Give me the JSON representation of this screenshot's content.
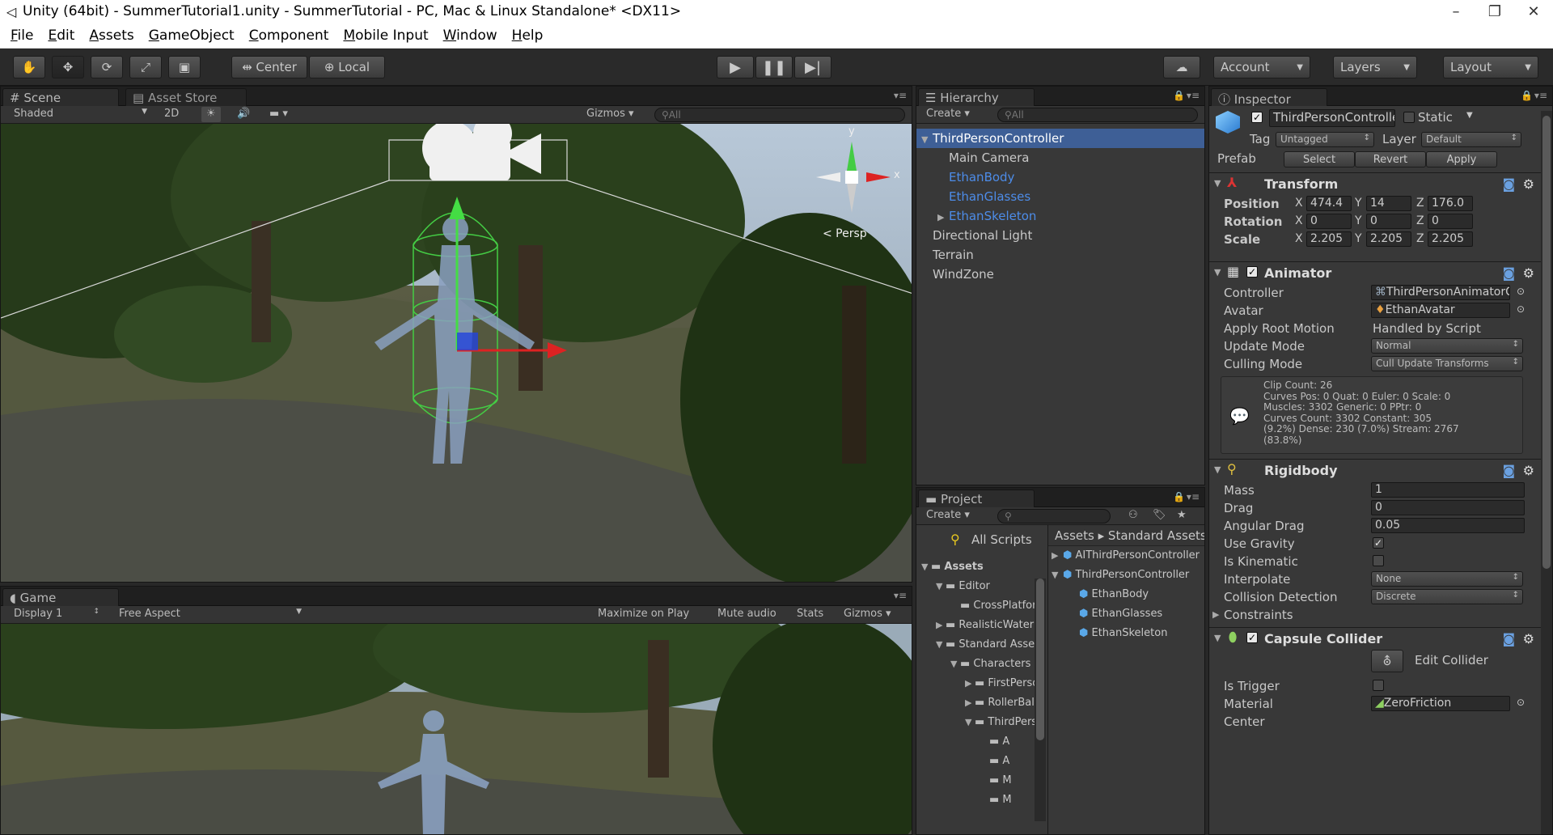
{
  "window": {
    "title": "Unity (64bit) - SummerTutorial1.unity - SummerTutorial - PC, Mac & Linux Standalone* <DX11>",
    "minimize": "–",
    "maximize": "❐",
    "close": "✕"
  },
  "menu": [
    "File",
    "Edit",
    "Assets",
    "GameObject",
    "Component",
    "Mobile Input",
    "Window",
    "Help"
  ],
  "toolbar": {
    "center": "Center",
    "local": "Local",
    "account": "Account",
    "layers": "Layers",
    "layout": "Layout"
  },
  "scene": {
    "tabs": [
      "Scene",
      "Asset Store"
    ],
    "shading": "Shaded",
    "mode2d": "2D",
    "gizmos": "Gizmos",
    "search": "All",
    "persp": "< Persp",
    "axis_y": "y",
    "axis_x": "x"
  },
  "game": {
    "tab": "Game",
    "display": "Display 1",
    "aspect": "Free Aspect",
    "maximize": "Maximize on Play",
    "mute": "Mute audio",
    "stats": "Stats",
    "gizmos": "Gizmos"
  },
  "hierarchy": {
    "tab": "Hierarchy",
    "create": "Create",
    "search": "All",
    "items": [
      {
        "label": "ThirdPersonController",
        "indent": 0,
        "selected": true,
        "fold": "▼",
        "blue": false
      },
      {
        "label": "Main Camera",
        "indent": 1,
        "selected": false,
        "fold": "",
        "blue": false
      },
      {
        "label": "EthanBody",
        "indent": 1,
        "selected": false,
        "fold": "",
        "blue": true
      },
      {
        "label": "EthanGlasses",
        "indent": 1,
        "selected": false,
        "fold": "",
        "blue": true
      },
      {
        "label": "EthanSkeleton",
        "indent": 1,
        "selected": false,
        "fold": "▶",
        "blue": true
      },
      {
        "label": "Directional Light",
        "indent": 0,
        "selected": false,
        "fold": "",
        "blue": false
      },
      {
        "label": "Terrain",
        "indent": 0,
        "selected": false,
        "fold": "",
        "blue": false
      },
      {
        "label": "WindZone",
        "indent": 0,
        "selected": false,
        "fold": "",
        "blue": false
      }
    ]
  },
  "project": {
    "tab": "Project",
    "create": "Create",
    "all_scripts": "All Scripts",
    "tree": [
      {
        "label": "Assets",
        "indent": 0,
        "fold": "▼",
        "bold": true
      },
      {
        "label": "Editor",
        "indent": 1,
        "fold": "▼",
        "bold": false
      },
      {
        "label": "CrossPlatformInput",
        "indent": 2,
        "fold": "",
        "bold": false
      },
      {
        "label": "RealisticWater",
        "indent": 1,
        "fold": "▶",
        "bold": false
      },
      {
        "label": "Standard Assets",
        "indent": 1,
        "fold": "▼",
        "bold": false
      },
      {
        "label": "Characters",
        "indent": 2,
        "fold": "▼",
        "bold": false
      },
      {
        "label": "FirstPerson",
        "indent": 3,
        "fold": "▶",
        "bold": false
      },
      {
        "label": "RollerBall",
        "indent": 3,
        "fold": "▶",
        "bold": false
      },
      {
        "label": "ThirdPerson",
        "indent": 3,
        "fold": "▼",
        "bold": false
      },
      {
        "label": "A",
        "indent": 4,
        "fold": "",
        "bold": false
      },
      {
        "label": "A",
        "indent": 4,
        "fold": "",
        "bold": false
      },
      {
        "label": "M",
        "indent": 4,
        "fold": "",
        "bold": false
      },
      {
        "label": "M",
        "indent": 4,
        "fold": "",
        "bold": false
      }
    ],
    "breadcrumb": [
      "Assets",
      "Standard Assets"
    ],
    "files": [
      {
        "label": "AIThirdPersonController",
        "indent": 0,
        "fold": "▶"
      },
      {
        "label": "ThirdPersonController",
        "indent": 0,
        "fold": "▼"
      },
      {
        "label": "EthanBody",
        "indent": 1,
        "fold": ""
      },
      {
        "label": "EthanGlasses",
        "indent": 1,
        "fold": ""
      },
      {
        "label": "EthanSkeleton",
        "indent": 1,
        "fold": ""
      }
    ]
  },
  "inspector": {
    "tab": "Inspector",
    "object_name": "ThirdPersonController",
    "static": "Static",
    "tag_label": "Tag",
    "tag": "Untagged",
    "layer_label": "Layer",
    "layer": "Default",
    "prefab_label": "Prefab",
    "prefab_select": "Select",
    "prefab_revert": "Revert",
    "prefab_apply": "Apply",
    "transform": {
      "title": "Transform",
      "rows": [
        {
          "label": "Position",
          "x": "474.4",
          "y": "14",
          "z": "176.0"
        },
        {
          "label": "Rotation",
          "x": "0",
          "y": "0",
          "z": "0"
        },
        {
          "label": "Scale",
          "x": "2.205",
          "y": "2.205",
          "z": "2.205"
        }
      ]
    },
    "animator": {
      "title": "Animator",
      "controller_label": "Controller",
      "controller": "ThirdPersonAnimatorController",
      "avatar_label": "Avatar",
      "avatar": "EthanAvatar",
      "root_motion_label": "Apply Root Motion",
      "root_motion": "Handled by Script",
      "update_label": "Update Mode",
      "update": "Normal",
      "culling_label": "Culling Mode",
      "culling": "Cull Update Transforms",
      "info": [
        "Clip Count: 26",
        "Curves Pos: 0 Quat: 0 Euler: 0 Scale: 0",
        "Muscles: 3302 Generic: 0 PPtr: 0",
        "Curves Count: 3302 Constant: 305",
        "(9.2%) Dense: 230 (7.0%) Stream: 2767",
        "(83.8%)"
      ]
    },
    "rigidbody": {
      "title": "Rigidbody",
      "mass_label": "Mass",
      "mass": "1",
      "drag_label": "Drag",
      "drag": "0",
      "angular_label": "Angular Drag",
      "angular": "0.05",
      "gravity_label": "Use Gravity",
      "gravity": true,
      "kinematic_label": "Is Kinematic",
      "kinematic": false,
      "interpolate_label": "Interpolate",
      "interpolate": "None",
      "collision_label": "Collision Detection",
      "collision": "Discrete",
      "constraints_label": "Constraints"
    },
    "capsule": {
      "title": "Capsule Collider",
      "edit": "Edit Collider",
      "trigger_label": "Is Trigger",
      "trigger": false,
      "material_label": "Material",
      "material": "ZeroFriction",
      "center_label": "Center"
    }
  }
}
